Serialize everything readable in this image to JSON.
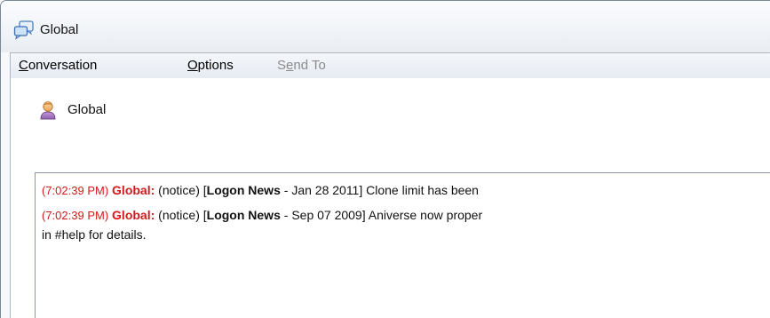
{
  "window": {
    "title": "Global",
    "icon": "chat-window-icon"
  },
  "menubar": {
    "items": [
      {
        "pre": "",
        "accel": "C",
        "post": "onversation",
        "enabled": true
      },
      {
        "pre": "",
        "accel": "O",
        "post": "ptions",
        "enabled": true
      },
      {
        "pre": "S",
        "accel": "e",
        "post": "nd To",
        "enabled": false
      }
    ]
  },
  "contact": {
    "name": "Global",
    "icon": "user-icon"
  },
  "messages": [
    {
      "timestamp": "(7:02:39 PM)",
      "sender": "Global:",
      "text1": " (notice) [",
      "bold": "Logon News",
      "text2": " - Jan 28 2011] Clone limit has been",
      "continuation": ""
    },
    {
      "timestamp": "(7:02:39 PM)",
      "sender": "Global:",
      "text1": " (notice) [",
      "bold": "Logon News",
      "text2": " - Sep 07 2009] Aniverse now proper",
      "continuation": "in #help for details."
    }
  ],
  "colors": {
    "timestamp": "#d51919",
    "sender": "#d51919"
  }
}
